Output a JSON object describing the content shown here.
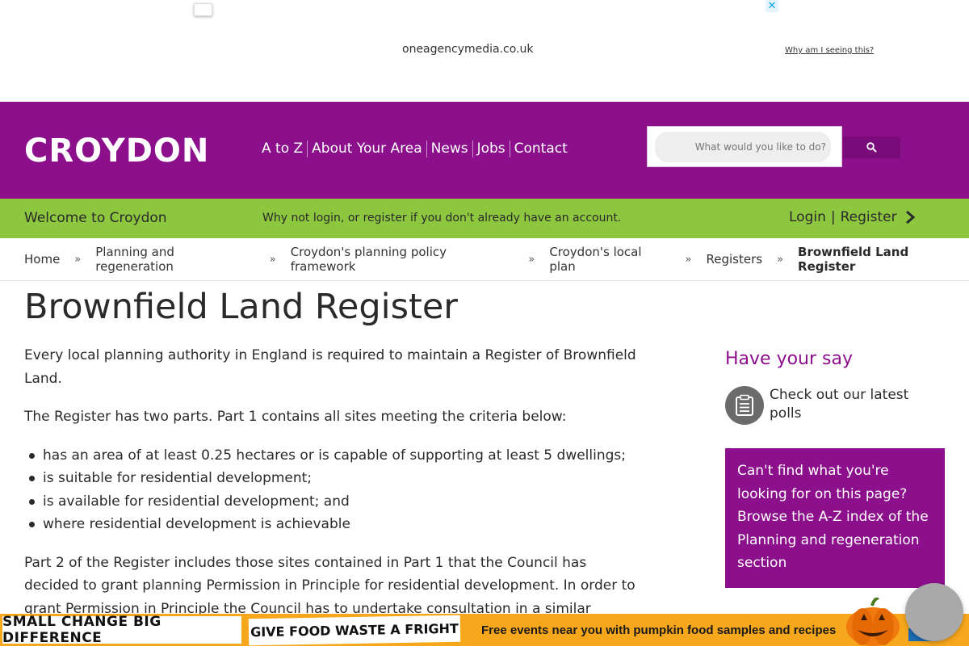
{
  "ad": {
    "domain": "oneagencymedia.co.uk",
    "why": "Why am I seeing this?",
    "close_glyph": "✕"
  },
  "header": {
    "logo": "CROYDON",
    "nav": [
      "A to Z",
      "About Your Area",
      "News",
      "Jobs",
      "Contact"
    ],
    "search_placeholder": "What would you like to do?",
    "brand_color": "#8c0f8c"
  },
  "welcome": {
    "title": "Welcome to Croydon",
    "message": "Why not login, or register if you don't already have an account.",
    "login": "Login",
    "separator": "|",
    "register": "Register",
    "bar_color": "#8dc63f"
  },
  "breadcrumb": {
    "items": [
      "Home",
      "Planning and regeneration",
      "Croydon's planning policy framework",
      "Croydon's local plan",
      "Registers"
    ],
    "separator": "»",
    "current": "Brownfield Land Register"
  },
  "main": {
    "title": "Brownfield Land Register",
    "intro": "Every local planning authority in England is required to maintain a Register of Brownfield Land.",
    "parts": "The Register has two parts. Part 1 contains all sites meeting the criteria below:",
    "criteria": [
      "has an area of at least 0.25 hectares or is capable of supporting at least 5 dwellings;",
      "is suitable for residential development;",
      "is available for residential development; and",
      "where residential development is achievable"
    ],
    "part2": "Part 2 of the Register includes those sites contained in Part 1 that the Council has decided to grant planning Permission in Principle for residential development. In order to grant Permission in Principle the Council has to undertake consultation in a similar manner"
  },
  "sidebar": {
    "title": "Have your say",
    "poll_link": "Check out our latest polls",
    "cant_find": "Can't find what you're looking for on this page? Browse the A-Z index of the Planning and regeneration section"
  },
  "banner": {
    "left": "SMALL CHANGE BIG DIFFERENCE",
    "mid": "GIVE FOOD WASTE A FRIGHT",
    "text": "Free events near you with pumpkin food samples and recipes",
    "bg_color": "#f7a71b"
  }
}
